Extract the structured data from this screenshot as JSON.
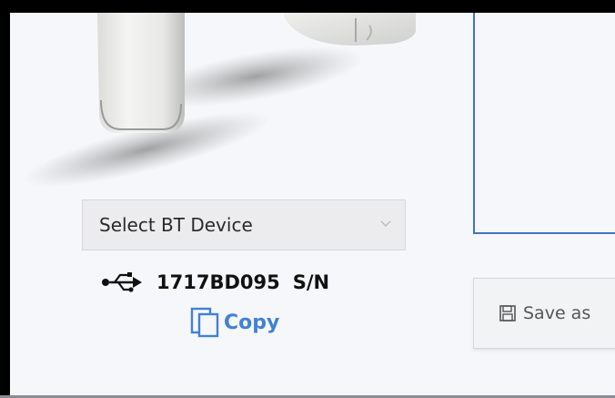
{
  "device_select": {
    "label": "Select BT Device",
    "chevron_icon": "chevron-down-icon"
  },
  "connection": {
    "icon": "usb-icon",
    "serial_number": "1717BD095",
    "serial_suffix": "S/N"
  },
  "copy": {
    "icon": "copy-icon",
    "label": "Copy",
    "color": "#3f82d8"
  },
  "save_button": {
    "icon": "floppy-disk-icon",
    "label": "Save as"
  },
  "colors": {
    "panel_border": "#3c76c2",
    "background": "#f6f7fa"
  }
}
